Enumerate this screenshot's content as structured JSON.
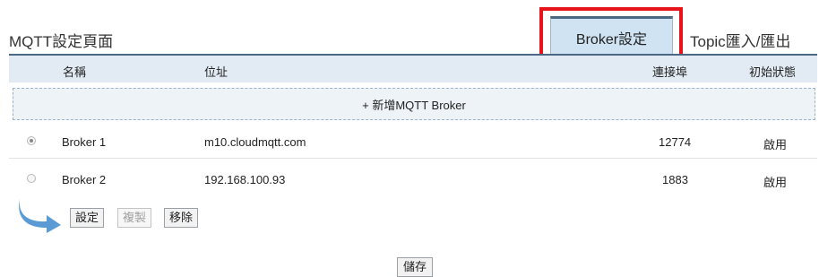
{
  "page": {
    "title": "MQTT設定頁面"
  },
  "tabs": [
    {
      "label": "Broker設定",
      "active": true
    },
    {
      "label": "Topic匯入/匯出",
      "active": false
    }
  ],
  "table": {
    "headers": {
      "name": "名稱",
      "address": "位址",
      "port": "連接埠",
      "initial_state": "初始狀態"
    },
    "add_label": "+ 新增MQTT Broker",
    "rows": [
      {
        "selected": true,
        "name": "Broker 1",
        "address": "m10.cloudmqtt.com",
        "port": "12774",
        "state": "啟用"
      },
      {
        "selected": false,
        "name": "Broker 2",
        "address": "192.168.100.93",
        "port": "1883",
        "state": "啟用"
      }
    ]
  },
  "actions": {
    "settings": "設定",
    "copy": "複製",
    "remove": "移除"
  },
  "save_label": "儲存",
  "colors": {
    "highlight": "#e8141b",
    "tab_active_bg": "#cfe3f3",
    "header_bg": "#e2ebf3",
    "arrow": "#5b9bd5"
  }
}
